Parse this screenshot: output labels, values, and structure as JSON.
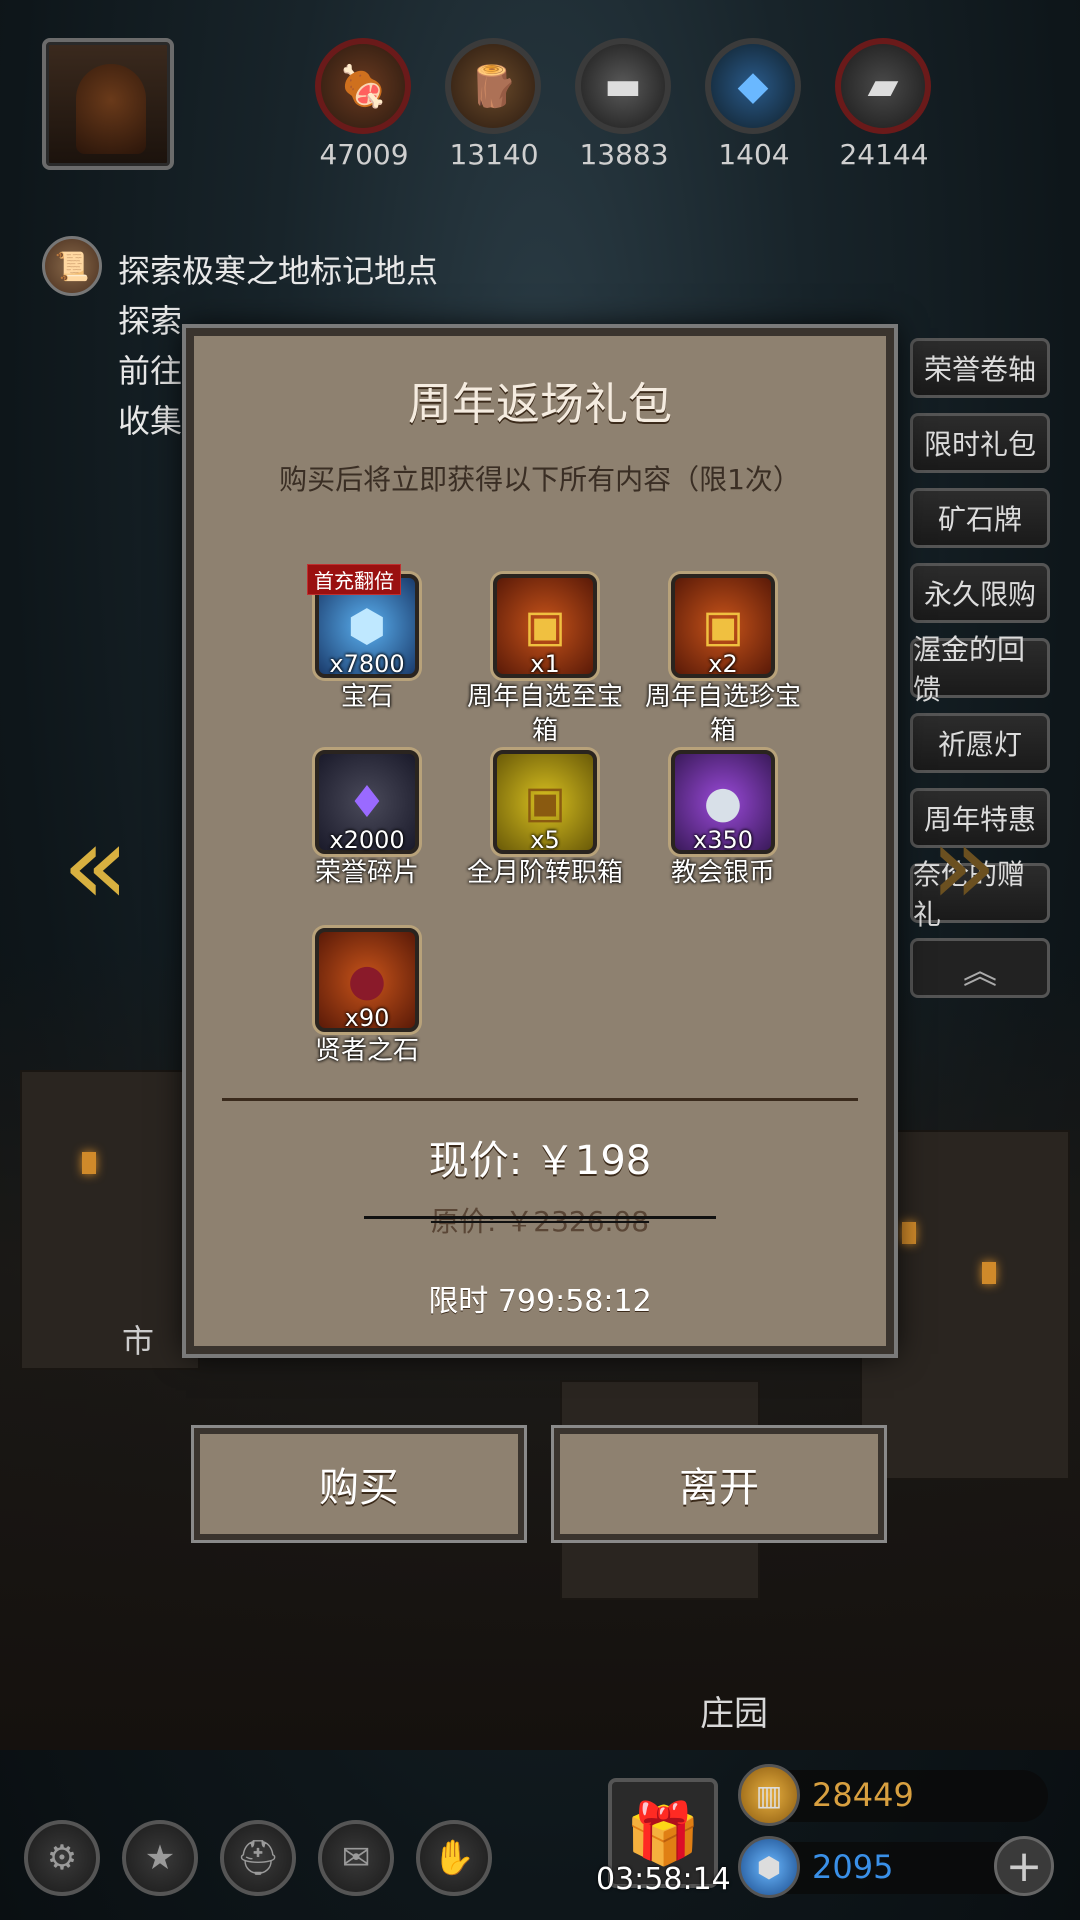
{
  "resources": [
    {
      "icon": "meat-icon",
      "value": "47009",
      "color": "#b84a1a"
    },
    {
      "icon": "wood-icon",
      "value": "13140",
      "color": "#a8742c"
    },
    {
      "icon": "iron-icon",
      "value": "13883",
      "color": "#8a8a8a"
    },
    {
      "icon": "crystal-icon",
      "value": "1404",
      "color": "#3a90d8"
    },
    {
      "icon": "steel-icon",
      "value": "24144",
      "color": "#707070"
    }
  ],
  "quest": {
    "line1": "探索极寒之地标记地点",
    "line2": "探索",
    "line3": "前往",
    "line4": "收集"
  },
  "side_menu": [
    "荣誉卷轴",
    "限时礼包",
    "矿石牌",
    "永久限购",
    "渥金的回馈",
    "祈愿灯",
    "周年特惠",
    "奈伦的赠礼"
  ],
  "dialog": {
    "title": "周年返场礼包",
    "subtitle": "购买后将立即获得以下所有内容（限1次）",
    "items": [
      {
        "name": "宝石",
        "qty": "x7800",
        "badge": "首充翻倍",
        "icon": "gem-icon",
        "bg": "#2a4a7a"
      },
      {
        "name": "周年自选至宝箱",
        "qty": "x1",
        "badge": "",
        "icon": "chest-icon",
        "bg": "#8a2a10"
      },
      {
        "name": "周年自选珍宝箱",
        "qty": "x2",
        "badge": "",
        "icon": "chest-icon",
        "bg": "#8a2a10"
      },
      {
        "name": "荣誉碎片",
        "qty": "x2000",
        "badge": "",
        "icon": "shard-icon",
        "bg": "#3a3a4a"
      },
      {
        "name": "全月阶转职箱",
        "qty": "x5",
        "badge": "",
        "icon": "chest-icon",
        "bg": "#8a7a10"
      },
      {
        "name": "教会银币",
        "qty": "x350",
        "badge": "",
        "icon": "coin-icon",
        "bg": "#6a2a8a"
      },
      {
        "name": "贤者之石",
        "qty": "x90",
        "badge": "",
        "icon": "stone-icon",
        "bg": "#8a2a10"
      }
    ],
    "price_now": "现价: ￥198",
    "price_old": "原价: ￥2326.08",
    "timer": "限时 799:58:12"
  },
  "buttons": {
    "buy": "购买",
    "leave": "离开"
  },
  "labels": {
    "shi": "市",
    "zhuang": "庄园"
  },
  "bottom": {
    "gift_timer": "03:58:14",
    "gold": "28449",
    "gem": "2095",
    "gold_color": "#d8a040",
    "gem_color": "#3a90e8"
  }
}
